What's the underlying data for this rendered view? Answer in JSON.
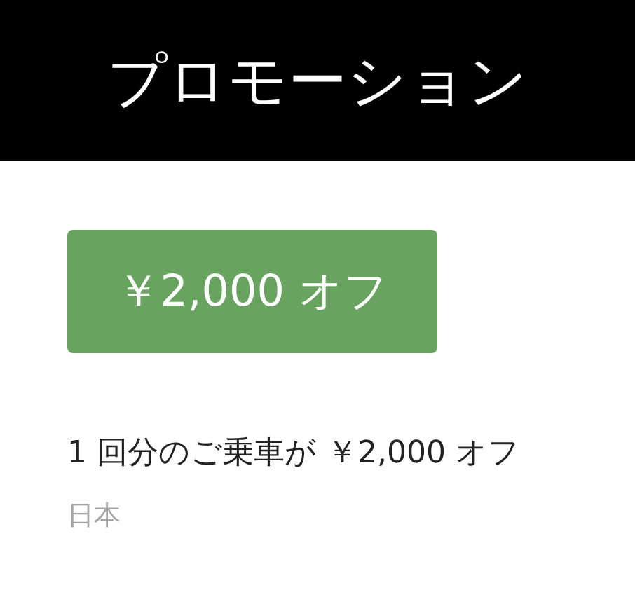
{
  "header": {
    "title": "プロモーション"
  },
  "promo": {
    "badge": "￥2,000 オフ",
    "description": "1 回分のご乗車が ￥2,000 オフ",
    "region": "日本"
  }
}
